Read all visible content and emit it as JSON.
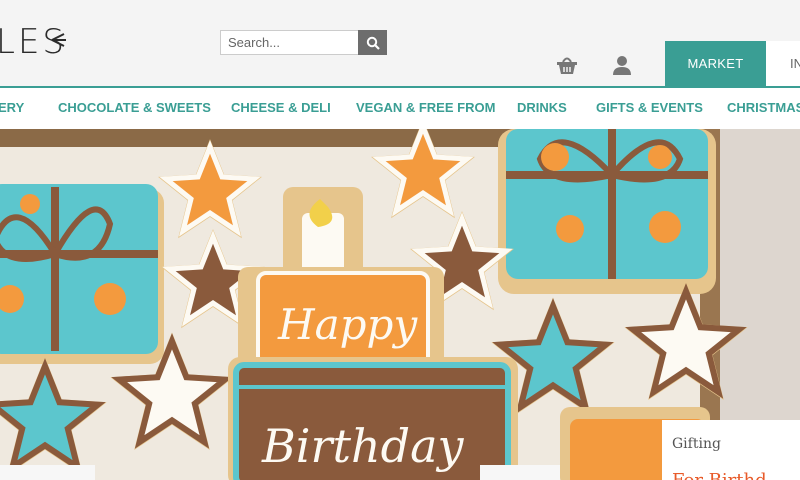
{
  "header": {
    "logo_text": "LES",
    "search": {
      "placeholder": "Search..."
    },
    "icons": {
      "search": "search-icon",
      "basket": "basket-icon",
      "account": "user-icon",
      "logo": "leaf-icon"
    },
    "tabs": [
      {
        "label": "MARKET",
        "active": true
      },
      {
        "label": "IN",
        "active": false
      }
    ]
  },
  "nav": {
    "items": [
      {
        "label": "ERY"
      },
      {
        "label": "CHOCOLATE & SWEETS"
      },
      {
        "label": "CHEESE & DELI"
      },
      {
        "label": "VEGAN & FREE FROM"
      },
      {
        "label": "DRINKS"
      },
      {
        "label": "GIFTS & EVENTS"
      },
      {
        "label": "CHRISTMAS"
      }
    ]
  },
  "hero": {
    "cookie_text_1": "Happy",
    "cookie_text_2": "Birthday",
    "card_title": "Gifting",
    "card_subtitle": "For Birthd"
  },
  "colors": {
    "accent": "#3a9e94",
    "cookie_blue": "#5cc6cd",
    "cookie_orange": "#f39a3e",
    "cookie_brown": "#8a5a3c",
    "icing_white": "#fdfaf3"
  }
}
